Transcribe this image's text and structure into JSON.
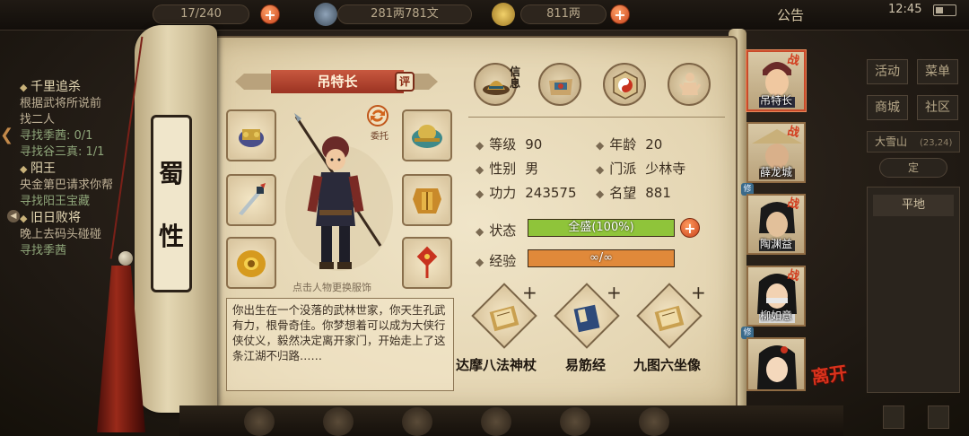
{
  "topbar": {
    "stamina": "17/240",
    "copper": "281两781文",
    "silver": "811两",
    "notice": "公告",
    "clock": "12:45"
  },
  "quests": [
    {
      "title": "千里追杀",
      "lines": [
        "根据武将所说前",
        "找二人"
      ],
      "subs": [
        "寻找季茜: 0/1",
        "寻找谷三真: 1/1"
      ]
    },
    {
      "title": "阳王",
      "lines": [
        "央金第巴请求你帮"
      ],
      "subs": [
        "寻找阳王宝藏"
      ]
    },
    {
      "title": "旧日败将",
      "lines": [
        "晚上去码头碰碰"
      ],
      "subs": [
        "寻找季茜"
      ]
    }
  ],
  "right_menu": {
    "buttons": [
      "活动",
      "菜单",
      "商城",
      "社区"
    ],
    "location": "大雪山",
    "location_coords": "(23,24)",
    "location_toggle": "定",
    "terrain": "平地"
  },
  "scroll": {
    "faction_chars": [
      "蜀",
      "性"
    ]
  },
  "character": {
    "name": "吊特长",
    "review_badge": "评",
    "delegate_label": "委托",
    "change_outfit_hint": "点击人物更换服饰",
    "bio": "你出生在一个没落的武林世家，你天生孔武有力，根骨奇佳。你梦想着可以成为大侠行侠仗义，毅然决定离开家门，开始走上了这条江湖不归路……"
  },
  "tabs": [
    {
      "icon": "hat-icon",
      "label": "信息"
    },
    {
      "icon": "bag-icon",
      "label": ""
    },
    {
      "icon": "yin-yang-icon",
      "label": ""
    },
    {
      "icon": "meridian-body-icon",
      "label": ""
    }
  ],
  "stats": {
    "level_label": "等级",
    "level": "90",
    "age_label": "年龄",
    "age": "20",
    "gender_label": "性别",
    "gender": "男",
    "sect_label": "门派",
    "sect": "少林寺",
    "power_label": "功力",
    "power": "243575",
    "fame_label": "名望",
    "fame": "881",
    "status_label": "状态",
    "status_text": "全盛(100%)",
    "status_fraction": 1.0,
    "exp_label": "经验",
    "exp_text": "∞/∞",
    "exp_fraction": 1.0
  },
  "skills": [
    {
      "name": "达摩八法神杖",
      "icon": "scroll-book-icon"
    },
    {
      "name": "易筋经",
      "icon": "blue-book-icon"
    },
    {
      "name": "九图六坐像",
      "icon": "scroll-book-icon"
    }
  ],
  "skill_plus": "+",
  "party": [
    {
      "name": "吊特长",
      "battle": "战",
      "training": "",
      "selected": true
    },
    {
      "name": "薛龙城",
      "battle": "战",
      "training": "修",
      "selected": false
    },
    {
      "name": "陶渊益",
      "battle": "战",
      "training": "",
      "selected": false
    },
    {
      "name": "柳如意",
      "battle": "战",
      "training": "修",
      "selected": false
    },
    {
      "name": "",
      "battle": "",
      "training": "",
      "selected": false
    }
  ],
  "leave_label": "离开",
  "colors": {
    "status_bar": "#8fc43a",
    "exp_bar": "#e0893a",
    "accent_red": "#c94a2a"
  }
}
